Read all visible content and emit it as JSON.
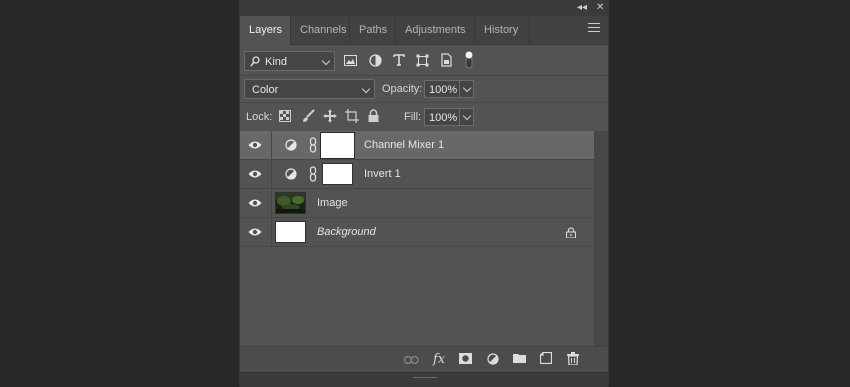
{
  "window": {
    "collapse_glyph": "◂◂",
    "close_glyph": "✕"
  },
  "tabs": [
    {
      "label": "Layers",
      "active": true
    },
    {
      "label": "Channels",
      "active": false
    },
    {
      "label": "Paths",
      "active": false
    },
    {
      "label": "Adjustments",
      "active": false
    },
    {
      "label": "History",
      "active": false
    }
  ],
  "filter": {
    "kind_label": "Kind",
    "filter_icons": [
      "image-filter-icon",
      "adjustment-filter-icon",
      "type-filter-icon",
      "shape-filter-icon",
      "smart-object-filter-icon",
      "filter-toggle-icon"
    ]
  },
  "blend": {
    "mode_value": "Color",
    "opacity_label": "Opacity:",
    "opacity_value": "100%"
  },
  "lock": {
    "label": "Lock:",
    "fill_label": "Fill:",
    "fill_value": "100%",
    "lock_icons": [
      "lock-transparent-pixels-icon",
      "lock-image-pixels-icon",
      "lock-position-icon",
      "lock-artboard-icon",
      "lock-all-icon"
    ]
  },
  "layers": [
    {
      "name": "Channel Mixer 1",
      "type": "adjustment",
      "selected": true,
      "visible": true
    },
    {
      "name": "Invert 1",
      "type": "adjustment",
      "selected": false,
      "visible": true
    },
    {
      "name": "Image",
      "type": "image",
      "selected": false,
      "visible": true
    },
    {
      "name": "Background",
      "type": "background",
      "selected": false,
      "visible": true,
      "locked": true
    }
  ],
  "footer": {
    "fx_label": "fx",
    "buttons": [
      "link-layers-icon",
      "layer-style-icon",
      "add-mask-icon",
      "new-adjustment-layer-icon",
      "new-group-icon",
      "new-layer-icon",
      "delete-layer-icon"
    ]
  },
  "colors": {
    "panel_bg": "#535353",
    "selected_row": "#686868",
    "page_bg": "#282828"
  }
}
